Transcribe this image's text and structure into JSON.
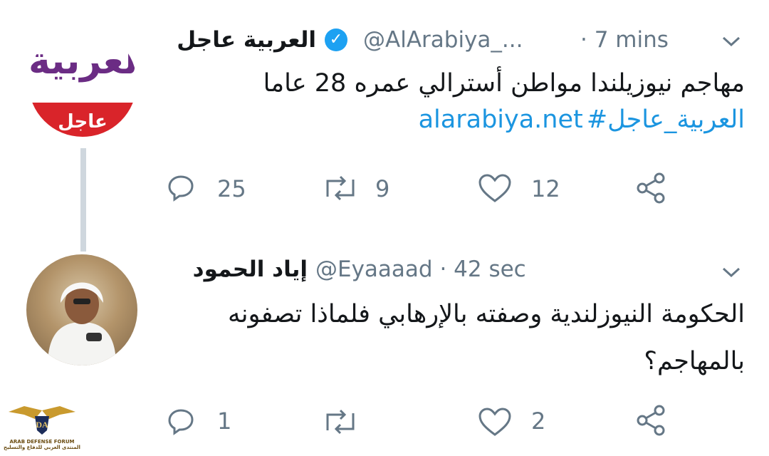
{
  "tweet1": {
    "name": "العربية عاجل",
    "handle": "@AlArabiya_...",
    "time": "· 7 mins",
    "text": "مهاجم نيوزيلندا مواطن أسترالي عمره 28 عاما",
    "hashtag": "#العربية_عاجل",
    "link": "alarabiya.net",
    "replies": "25",
    "retweets": "9",
    "likes": "12",
    "avatar_brand": "العربية",
    "avatar_band": "عاجل"
  },
  "tweet2": {
    "name": "إياد الحمود",
    "handle": "@Eyaaaad · 42 sec",
    "text_line1": "الحكومة النيوزلندية وصفته بالإرهابي فلماذا تصفونه",
    "text_line2": "بالمهاجم؟",
    "replies": "1",
    "retweets": "",
    "likes": "2"
  },
  "watermark": {
    "badge": "DA",
    "line1": "ARAB DEFENSE FORUM",
    "line2": "المنتدى العربي للدفاع والتسليح"
  },
  "colors": {
    "link": "#1b95e0",
    "verified": "#1da1f2",
    "muted": "#657786",
    "brand_purple": "#6b2c84",
    "brand_red": "#d9242a"
  }
}
